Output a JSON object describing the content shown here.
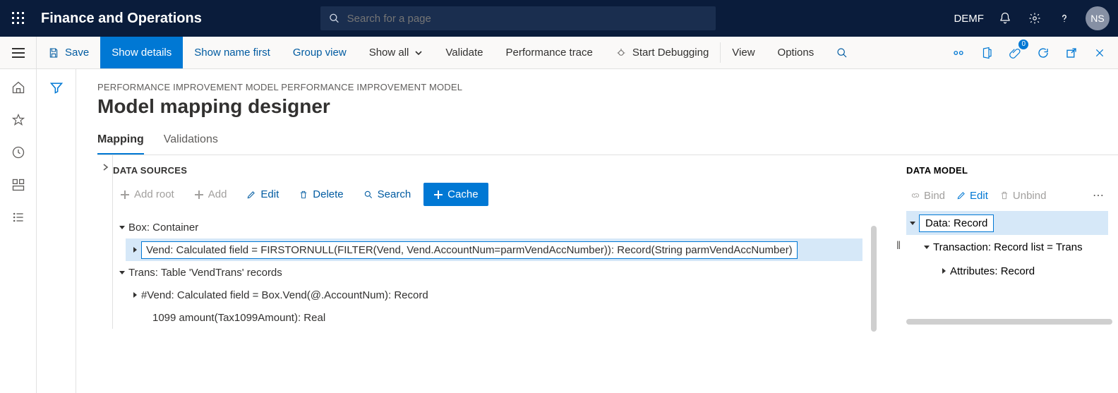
{
  "topbar": {
    "brand": "Finance and Operations",
    "search_placeholder": "Search for a page",
    "company": "DEMF",
    "avatar": "NS"
  },
  "cmdbar": {
    "save": "Save",
    "show_details": "Show details",
    "show_name_first": "Show name first",
    "group_view": "Group view",
    "show_all": "Show all",
    "validate": "Validate",
    "perf_trace": "Performance trace",
    "start_debug": "Start Debugging",
    "view": "View",
    "options": "Options",
    "attach_badge": "0"
  },
  "breadcrumb": "PERFORMANCE IMPROVEMENT MODEL PERFORMANCE IMPROVEMENT MODEL",
  "page_title": "Model mapping designer",
  "tabs": {
    "mapping": "Mapping",
    "validations": "Validations"
  },
  "ds": {
    "title": "DATA SOURCES",
    "add_root": "Add root",
    "add": "Add",
    "edit": "Edit",
    "delete": "Delete",
    "search": "Search",
    "cache": "Cache",
    "tree": {
      "box": "Box: Container",
      "vend": "Vend: Calculated field = FIRSTORNULL(FILTER(Vend, Vend.AccountNum=parmVendAccNumber)): Record(String parmVendAccNumber)",
      "trans": "Trans: Table 'VendTrans' records",
      "hash_vend": "#Vend: Calculated field = Box.Vend(@.AccountNum): Record",
      "tax": "1099 amount(Tax1099Amount): Real"
    }
  },
  "dm": {
    "title": "DATA MODEL",
    "bind": "Bind",
    "edit": "Edit",
    "unbind": "Unbind",
    "tree": {
      "data": "Data: Record",
      "transaction": "Transaction: Record list = Trans",
      "attributes": "Attributes: Record"
    }
  }
}
